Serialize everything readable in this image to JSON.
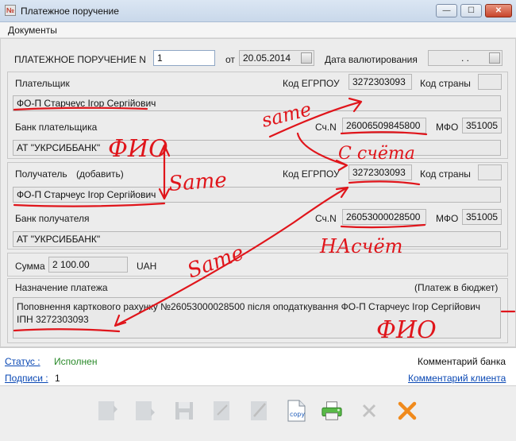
{
  "window": {
    "title": "Платежное поручение",
    "min_glyph": "—",
    "max_glyph": "☐",
    "close_glyph": "✕",
    "app_icon_glyph": "№"
  },
  "menu": {
    "documents": "Документы"
  },
  "header": {
    "label": "ПЛАТЕЖНОЕ ПОРУЧЕНИЕ N",
    "number": "1",
    "date_prefix": "от",
    "date": "20.05.2014",
    "currency_date_label": "Дата валютирования",
    "currency_date_value": ". ."
  },
  "payer": {
    "label": "Плательщик",
    "edrpou_label": "Код ЕГРПОУ",
    "edrpou": "3272303093",
    "country_label": "Код страны",
    "country": "",
    "name": "ФО-П Старчеус Ігор Сергійович",
    "bank_label": "Банк плательщика",
    "account_label": "Сч.N",
    "account": "26006509845800",
    "mfo_label": "МФО",
    "mfo": "351005",
    "bank_name": "АТ \"УКРСИББАНК\""
  },
  "recipient": {
    "label": "Получатель",
    "add_label": "(добавить)",
    "edrpou_label": "Код ЕГРПОУ",
    "edrpou": "3272303093",
    "country_label": "Код страны",
    "country": "",
    "name": "ФО-П Старчеус Ігор Сергійович",
    "bank_label": "Банк получателя",
    "account_label": "Сч.N",
    "account": "26053000028500",
    "mfo_label": "МФО",
    "mfo": "351005",
    "bank_name": "АТ \"УКРСИББАНК\""
  },
  "amount": {
    "label": "Сумма",
    "value": "2 100.00",
    "currency": "UAH"
  },
  "purpose": {
    "label": "Назначение платежа",
    "budget_note": "(Платеж в бюджет)",
    "line1": "Поповнення карткового рахунку №26053000028500 після оподаткування ФО-П Старчеус Ігор Сергійович",
    "line2": "ІПН 3272303093"
  },
  "status": {
    "status_label": "Статус :",
    "status_value": "Исполнен",
    "signatures_label": "Подписи :",
    "signatures_value": "1",
    "bank_comment": "Комментарий банка",
    "client_comment": "Комментарий клиента"
  },
  "toolbar": {
    "copy_label": "copy"
  },
  "annotations": {
    "same_top": "same",
    "fio_left": "ФИО",
    "same_left": "Same",
    "s_scheta": "С счёта",
    "na_schet": "НАсчёт",
    "same_diag": "Same",
    "fio_bottom": "ФИО"
  },
  "colors": {
    "ink": "#e0151b",
    "link": "#0a48b4",
    "status_ok": "#2a8a2a",
    "close_btn": "#c8452c"
  }
}
